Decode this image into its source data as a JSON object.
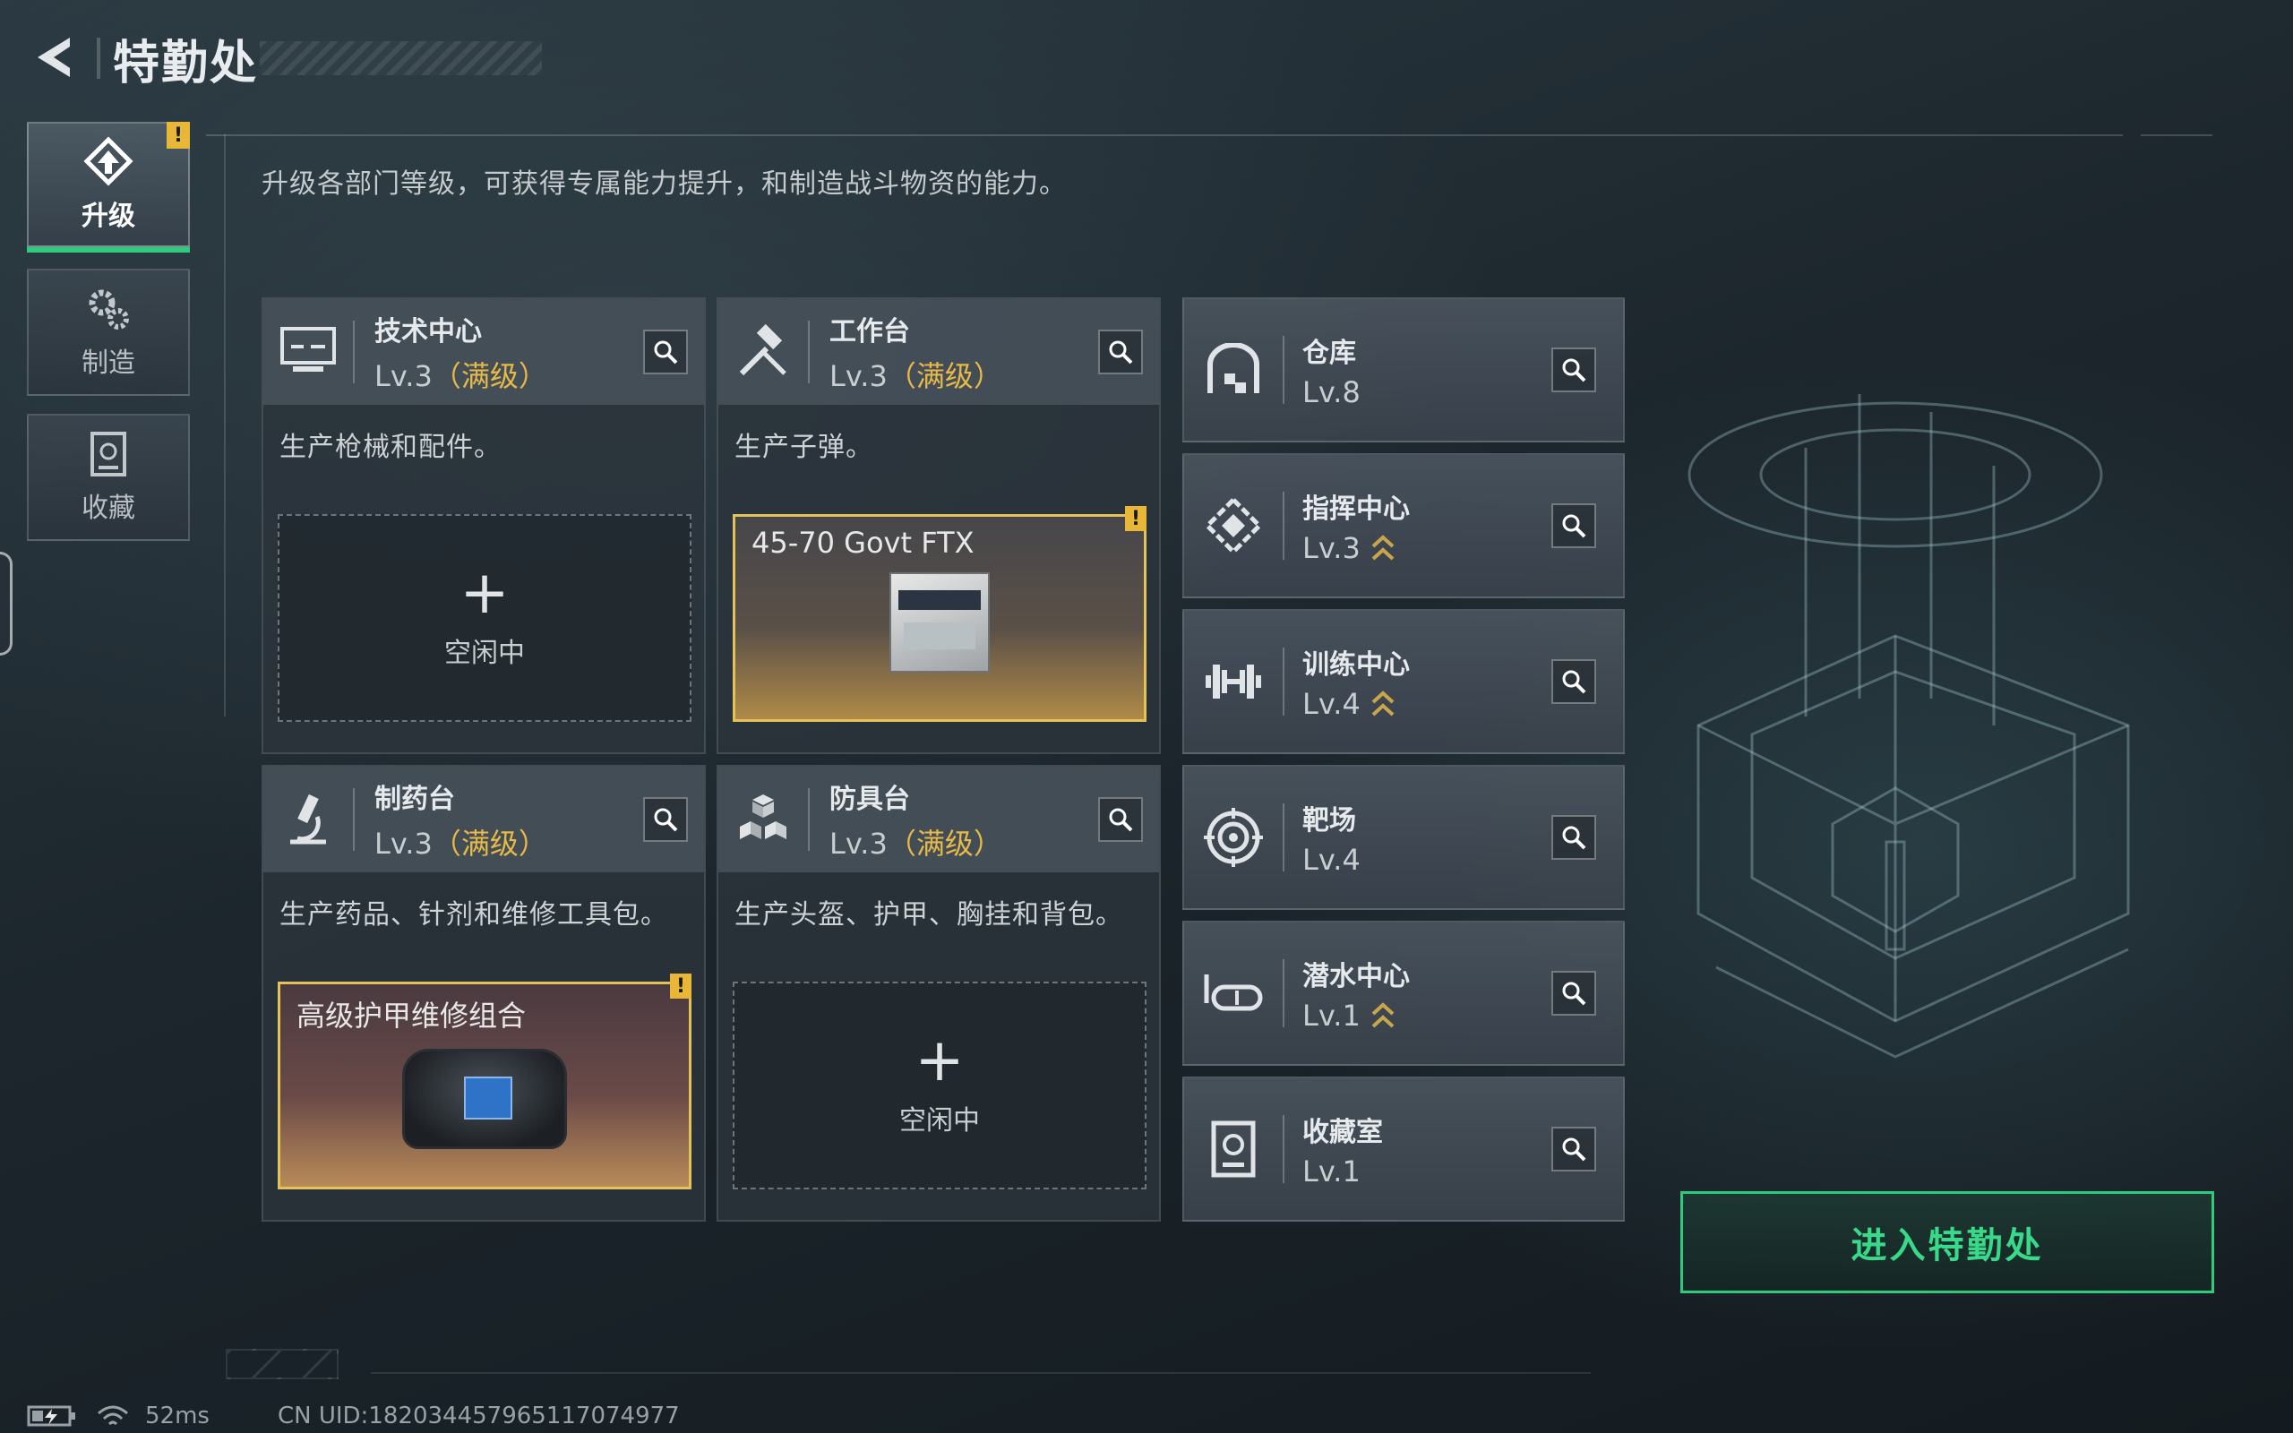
{
  "header": {
    "title": "特勤处"
  },
  "sidebar": {
    "tabs": [
      {
        "label": "升级",
        "active": true,
        "badge": "!"
      },
      {
        "label": "制造",
        "active": false
      },
      {
        "label": "收藏",
        "active": false
      }
    ]
  },
  "subtitle": "升级各部门等级，可获得专属能力提升，和制造战斗物资的能力。",
  "departments": [
    {
      "name": "技术中心",
      "level": "Lv.3",
      "max": "（满级）",
      "desc": "生产枪械和配件。",
      "slot": {
        "state": "idle",
        "text": "空闲中"
      }
    },
    {
      "name": "工作台",
      "level": "Lv.3",
      "max": "（满级）",
      "desc": "生产子弹。",
      "slot": {
        "state": "crafting",
        "text": "45-70 Govt FTX",
        "badge": "!"
      }
    },
    {
      "name": "制药台",
      "level": "Lv.3",
      "max": "（满级）",
      "desc": "生产药品、针剂和维修工具包。",
      "slot": {
        "state": "crafting",
        "text": "高级护甲维修组合",
        "badge": "!"
      }
    },
    {
      "name": "防具台",
      "level": "Lv.3",
      "max": "（满级）",
      "desc": "生产头盔、护甲、胸挂和背包。",
      "slot": {
        "state": "idle",
        "text": "空闲中"
      }
    }
  ],
  "facilities": [
    {
      "name": "仓库",
      "level": "Lv.8",
      "upgradable": false
    },
    {
      "name": "指挥中心",
      "level": "Lv.3",
      "upgradable": true
    },
    {
      "name": "训练中心",
      "level": "Lv.4",
      "upgradable": true
    },
    {
      "name": "靶场",
      "level": "Lv.4",
      "upgradable": false
    },
    {
      "name": "潜水中心",
      "level": "Lv.1",
      "upgradable": true
    },
    {
      "name": "收藏室",
      "level": "Lv.1",
      "upgradable": false
    }
  ],
  "enter_button": "进入特勤处",
  "status": {
    "ping": "52ms",
    "uid": "CN UID:1820344579651170749​77"
  },
  "colors": {
    "accent_green": "#2ecb7e",
    "max_gold": "#e6b949",
    "badge_yellow": "#e9b737"
  }
}
